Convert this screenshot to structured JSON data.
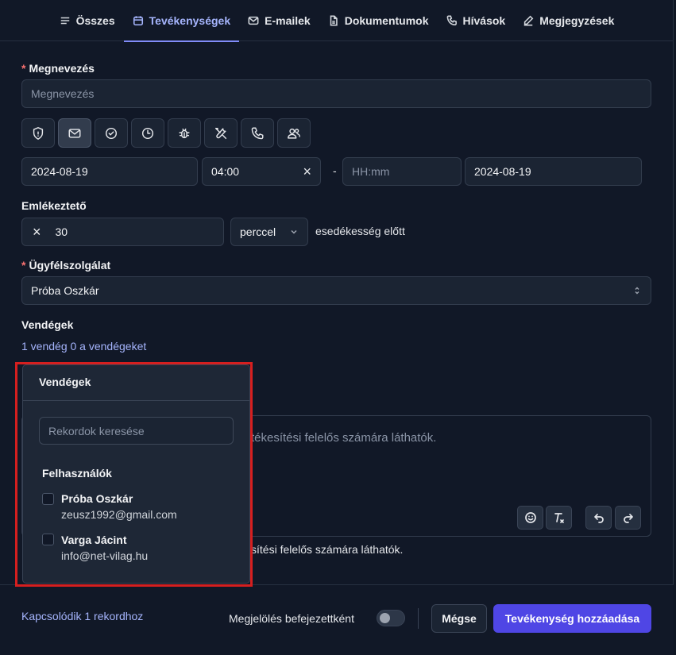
{
  "tabs": [
    {
      "label": "Összes",
      "icon": "list-icon"
    },
    {
      "label": "Tevékenységek",
      "icon": "calendar-icon",
      "active": true
    },
    {
      "label": "E-mailek",
      "icon": "mail-icon"
    },
    {
      "label": "Dokumentumok",
      "icon": "document-icon"
    },
    {
      "label": "Hívások",
      "icon": "phone-icon"
    },
    {
      "label": "Megjegyzések",
      "icon": "pencil-icon"
    }
  ],
  "form": {
    "name_label": "Megnevezés",
    "name_placeholder": "Megnevezés",
    "type_icons": [
      "shield-icon",
      "mail-icon",
      "check-circle-icon",
      "clock-icon",
      "bug-icon",
      "tools-icon",
      "phone-icon",
      "users-icon"
    ],
    "start_date": "2024-08-19",
    "start_time": "04:00",
    "clear_glyph": "×",
    "range_separator": "-",
    "end_time_placeholder": "HH:mm",
    "end_date": "2024-08-19",
    "reminder_label": "Emlékeztető",
    "reminder_value": "30",
    "reminder_unit": "perccel",
    "reminder_suffix": "esedékesség előtt",
    "owner_label": "Ügyfélszolgálat",
    "owner_value": "Próba Oszkár",
    "guests_label": "Vendégek",
    "guests_link": "1 vendég 0 a vendégeket",
    "editor_placeholder_fragment": "tékesítési felelős számára láthatók.",
    "editor_hint_fragment": "sítési felelős számára láthatók."
  },
  "popover": {
    "title": "Vendégek",
    "search_placeholder": "Rekordok keresése",
    "group_label": "Felhasználók",
    "users": [
      {
        "name": "Próba Oszkár",
        "email": "zeusz1992@gmail.com"
      },
      {
        "name": "Varga Jácint",
        "email": "info@net-vilag.hu"
      }
    ]
  },
  "footer": {
    "related_link": "Kapcsolódik 1 rekordhoz",
    "mark_done_label": "Megjelölés befejezettként",
    "cancel_label": "Mégse",
    "submit_label": "Tevékenység hozzáadása"
  },
  "colors": {
    "accent": "#4f46e5",
    "link": "#a5b4fc",
    "highlight": "#d61f1f"
  }
}
